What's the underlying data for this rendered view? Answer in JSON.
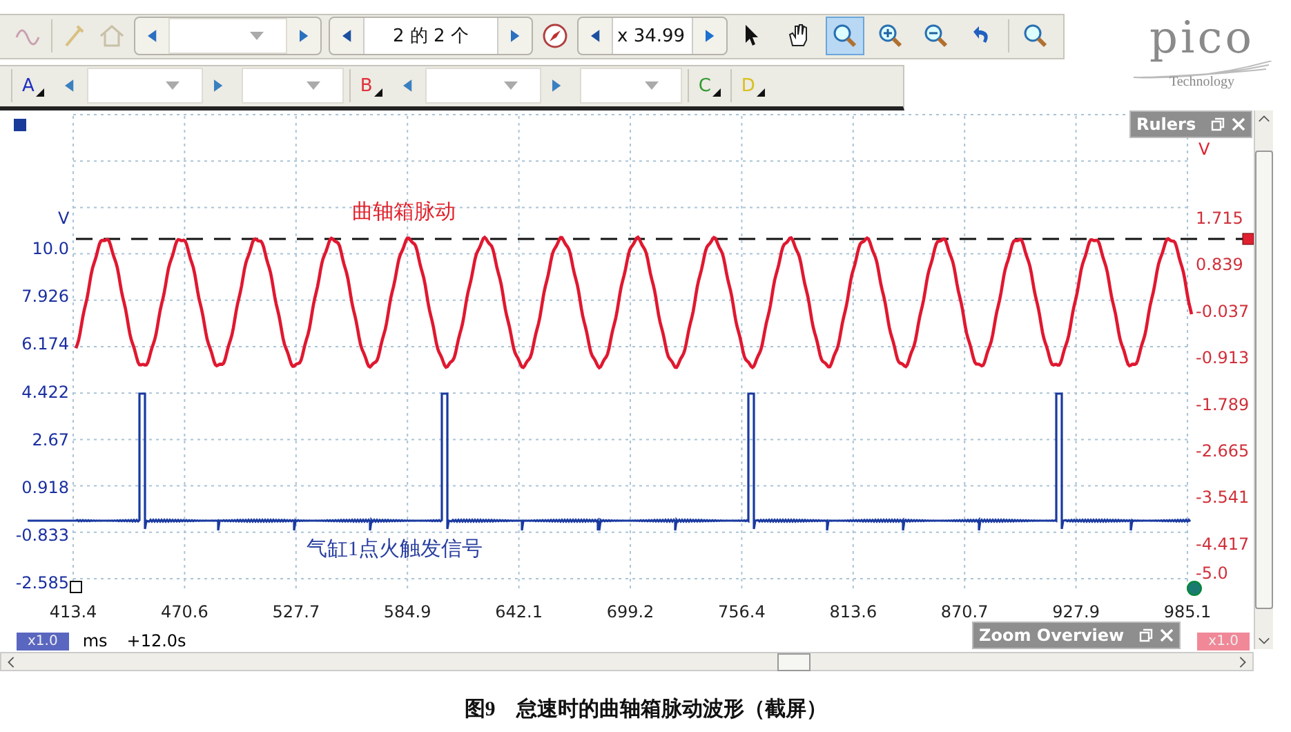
{
  "toolbar": {
    "page_field": "2 的 2 个",
    "zoom_field": "x 34.99",
    "tools": [
      {
        "kind": "pointer",
        "selected": false
      },
      {
        "kind": "hand",
        "selected": false
      },
      {
        "kind": "zoom-box",
        "selected": true
      },
      {
        "kind": "zoom-in",
        "selected": false
      },
      {
        "kind": "zoom-out",
        "selected": false
      },
      {
        "kind": "undo",
        "selected": false
      },
      {
        "kind": "zoom-fit",
        "selected": false
      }
    ]
  },
  "channels": [
    {
      "label": "A",
      "color": "#1f2fc0",
      "kind": "full"
    },
    {
      "label": "B",
      "color": "#e0303a",
      "kind": "full"
    },
    {
      "label": "C",
      "color": "#2e9a2e",
      "kind": "button"
    },
    {
      "label": "D",
      "color": "#d8c020",
      "kind": "button"
    }
  ],
  "logo": {
    "name": "pico",
    "subtitle": "Technology"
  },
  "plot": {
    "left_unit": "V",
    "left_ticks": [
      "10.0",
      "7.926",
      "6.174",
      "4.422",
      "2.67",
      "0.918",
      "-0.833",
      "-2.585"
    ],
    "right_unit": "V",
    "right_ticks": [
      "1.715",
      "0.839",
      "-0.037",
      "-0.913",
      "-1.789",
      "-2.665",
      "-3.541",
      "-4.417",
      "-5.0"
    ],
    "x_ticks": [
      "413.4",
      "470.6",
      "527.7",
      "584.9",
      "642.1",
      "699.2",
      "756.4",
      "813.6",
      "870.7",
      "927.9",
      "985.1"
    ],
    "labels": [
      {
        "text": "曲轴箱脉动",
        "color": "#e0202a"
      },
      {
        "text": "气缸1点火触发信号",
        "color": "#2a3fa0"
      }
    ]
  },
  "rulers": {
    "title": "Rulers"
  },
  "zoom_overview": {
    "title": "Zoom Overview"
  },
  "status": {
    "left_scale": "x1.0",
    "unit": "ms",
    "offset": "+12.0s",
    "right_scale": "x1.0"
  },
  "caption": {
    "figure": "图9",
    "text": "怠速时的曲轴箱脉动波形（截屏）"
  }
}
